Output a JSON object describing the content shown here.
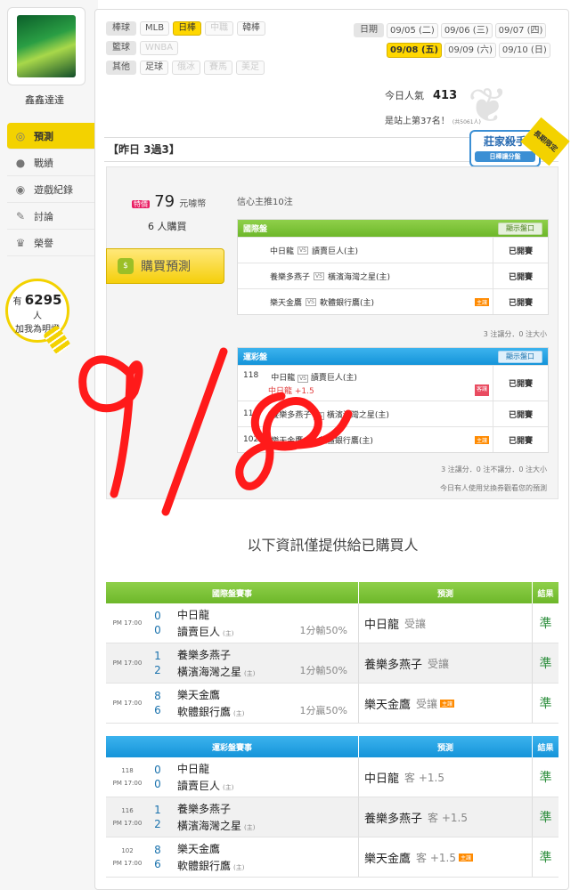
{
  "sidebar": {
    "username": "鑫鑫達達",
    "menu": [
      {
        "label": "預測",
        "icon": "target-icon"
      },
      {
        "label": "戰績",
        "icon": "chat-icon"
      },
      {
        "label": "遊戲紀錄",
        "icon": "record-icon"
      },
      {
        "label": "討論",
        "icon": "edit-icon"
      },
      {
        "label": "榮譽",
        "icon": "trophy-icon"
      }
    ],
    "fans_prefix": "有",
    "fans_count": "6295",
    "fans_suffix": "人",
    "fans_note": "加我為明燈"
  },
  "filters": [
    {
      "label": "棒球",
      "items": [
        {
          "t": "MLB",
          "s": "normal"
        },
        {
          "t": "日棒",
          "s": "on"
        },
        {
          "t": "中職",
          "s": "off"
        },
        {
          "t": "韓棒",
          "s": "normal"
        }
      ]
    },
    {
      "label": "籃球",
      "items": [
        {
          "t": "WNBA",
          "s": "off"
        }
      ]
    },
    {
      "label": "其他",
      "items": [
        {
          "t": "足球",
          "s": "normal"
        },
        {
          "t": "俄冰",
          "s": "off"
        },
        {
          "t": "賽馬",
          "s": "off"
        },
        {
          "t": "美足",
          "s": "off"
        }
      ]
    }
  ],
  "dates": {
    "label": "日期",
    "row1": [
      "09/05 (二)",
      "09/06 (三)",
      "09/07 (四)"
    ],
    "row2": [
      "09/08 (五)",
      "09/09 (六)",
      "09/10 (日)"
    ],
    "selected": "09/08 (五)"
  },
  "stats": {
    "pop_label": "今日人氣",
    "pop_value": "413",
    "rank_text": "是站上第37名！",
    "rank_small": "(共5061人)"
  },
  "record": {
    "title": "【昨日 3過3】"
  },
  "badge": {
    "title": "莊家殺手",
    "sub": "日棒讓分盤",
    "corner": "長期限定"
  },
  "purchase": {
    "price_tag": "特價",
    "price": "79",
    "price_unit": "元噱幣",
    "buyers": "6 人購買",
    "button": "購買預測",
    "confidence": "信心主推10注"
  },
  "intl": {
    "title": "國際盤",
    "show": "顯示盤口",
    "rows": [
      {
        "away": "中日龍",
        "home": "讀賣巨人(主)",
        "tag": "",
        "status": "已開賽"
      },
      {
        "away": "養樂多燕子",
        "home": "橫濱海灣之星(主)",
        "tag": "",
        "status": "已開賽"
      },
      {
        "away": "樂天金鷹",
        "home": "軟體銀行鷹(主)",
        "tag": "主讓",
        "status": "已開賽"
      }
    ],
    "note": "3 注讓分．0 注大小"
  },
  "sports": {
    "title": "運彩盤",
    "show": "顯示盤口",
    "rows": [
      {
        "num": "118",
        "away": "中日龍",
        "home": "讀賣巨人(主)",
        "line": "中日龍 +1.5",
        "tag": "客讓",
        "status": "已開賽"
      },
      {
        "num": "116",
        "away": "養樂多燕子",
        "home": "橫濱海灣之星(主)",
        "line": "",
        "tag": "",
        "status": "已開賽"
      },
      {
        "num": "102",
        "away": "樂天金鷹",
        "home": "軟體銀行鷹(主)",
        "line": "",
        "tag": "主讓",
        "status": "已開賽"
      }
    ],
    "note": "3 注讓分．0 注不讓分．0 注大小",
    "note2": "今日有人使用兌換券觀看您的預測"
  },
  "handwriting": "9/8",
  "info_text": "以下資訊僅提供給已購買人",
  "results_intl": {
    "headers": [
      "國際盤賽事",
      "預測",
      "結果"
    ],
    "rows": [
      {
        "num": "",
        "time": "PM 17:00",
        "s1": "0",
        "s2": "0",
        "t1": "中日龍",
        "t2": "讀賣巨人",
        "home": "(主)",
        "outcome": "1分輸50%",
        "pick": "中日龍",
        "ptype": "受讓",
        "ptag": "",
        "result": "準"
      },
      {
        "num": "",
        "time": "PM 17:00",
        "s1": "1",
        "s2": "2",
        "t1": "養樂多燕子",
        "t2": "橫濱海灣之星",
        "home": "(主)",
        "outcome": "1分輸50%",
        "pick": "養樂多燕子",
        "ptype": "受讓",
        "ptag": "",
        "result": "準"
      },
      {
        "num": "",
        "time": "PM 17:00",
        "s1": "8",
        "s2": "6",
        "t1": "樂天金鷹",
        "t2": "軟體銀行鷹",
        "home": "(主)",
        "outcome": "1分贏50%",
        "pick": "樂天金鷹",
        "ptype": "受讓",
        "ptag": "主讓",
        "result": "準"
      }
    ]
  },
  "results_sports": {
    "headers": [
      "運彩盤賽事",
      "預測",
      "結果"
    ],
    "rows": [
      {
        "num": "118",
        "time": "PM 17:00",
        "s1": "0",
        "s2": "0",
        "t1": "中日龍",
        "t2": "讀賣巨人",
        "home": "(主)",
        "pick": "中日龍",
        "ptype": "客 +1.5",
        "ptag": "",
        "result": "準"
      },
      {
        "num": "116",
        "time": "PM 17:00",
        "s1": "1",
        "s2": "2",
        "t1": "養樂多燕子",
        "t2": "橫濱海灣之星",
        "home": "(主)",
        "pick": "養樂多燕子",
        "ptype": "客 +1.5",
        "ptag": "",
        "result": "準"
      },
      {
        "num": "102",
        "time": "PM 17:00",
        "s1": "8",
        "s2": "6",
        "t1": "樂天金鷹",
        "t2": "軟體銀行鷹",
        "home": "(主)",
        "pick": "樂天金鷹",
        "ptype": "客 +1.5",
        "ptag": "主讓",
        "result": "準"
      }
    ]
  }
}
